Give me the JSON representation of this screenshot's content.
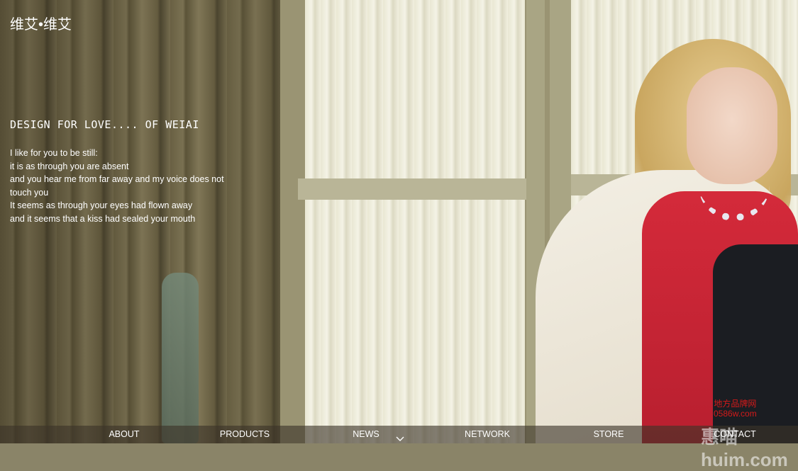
{
  "brand": {
    "logo": "维艾•维艾"
  },
  "hero": {
    "headline": "DESIGN FOR LOVE.... OF WEIAI",
    "poem": [
      "I like for you to be still:",
      "it is as through you are absent",
      "and you hear me from far away and my voice does not touch you",
      "It seems as through your eyes had flown away",
      "and it seems that a kiss had sealed your mouth"
    ]
  },
  "nav": {
    "items": [
      "ABOUT",
      "PRODUCTS",
      "NEWS",
      "NETWORK",
      "STORE",
      "CONTACT"
    ],
    "indicator_icon": "chevron-down-icon"
  },
  "watermark": {
    "line1": "地方品牌网",
    "line2": "0586w.com",
    "big": "惠喵 huim.com"
  },
  "colors": {
    "text": "#ffffff",
    "nav_bg": "rgba(60,52,40,0.62)",
    "watermark_red": "#d41a1a",
    "dress_red": "#d42a3a"
  }
}
